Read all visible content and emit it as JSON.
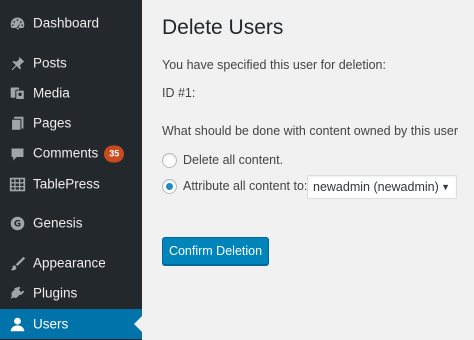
{
  "sidebar": {
    "items": [
      {
        "label": "Dashboard",
        "icon": "dashboard-icon"
      },
      {
        "label": "Posts",
        "icon": "pushpin-icon"
      },
      {
        "label": "Media",
        "icon": "media-icon"
      },
      {
        "label": "Pages",
        "icon": "pages-icon"
      },
      {
        "label": "Comments",
        "icon": "comment-icon",
        "badge": "35"
      },
      {
        "label": "TablePress",
        "icon": "table-icon"
      },
      {
        "label": "Genesis",
        "icon": "genesis-icon"
      },
      {
        "label": "Appearance",
        "icon": "brush-icon"
      },
      {
        "label": "Plugins",
        "icon": "plugin-icon"
      },
      {
        "label": "Users",
        "icon": "user-icon",
        "active": true
      }
    ]
  },
  "main": {
    "title": "Delete Users",
    "specified_text": "You have specified this user for deletion:",
    "user_id": "ID #1:",
    "question": "What should be done with content owned by this user",
    "option_delete": "Delete all content.",
    "option_attribute": "Attribute all content to:",
    "selected_user": "newadmin (newadmin)",
    "confirm_button": "Confirm Deletion"
  },
  "colors": {
    "sidebar_bg": "#23282d",
    "active_bg": "#0073aa",
    "badge": "#ca4a1f",
    "button": "#0085ba"
  }
}
